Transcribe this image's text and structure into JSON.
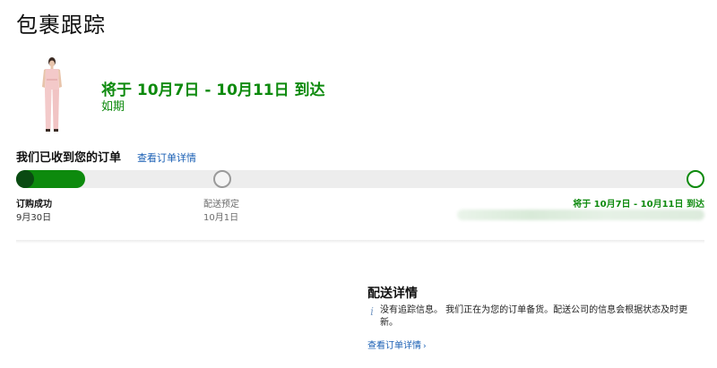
{
  "page": {
    "title": "包裹跟踪"
  },
  "shipment": {
    "headline": "将于 10月7日 - 10月11日 到达",
    "status": "如期",
    "product_image_icon": "dress-icon"
  },
  "order": {
    "received_title": "我们已收到您的订单",
    "view_details_link": "查看订单详情"
  },
  "progress": {
    "completed_fraction": 0.1,
    "steps": [
      {
        "name": "订购成功",
        "date": "9月30日",
        "state": "complete"
      },
      {
        "name": "配送预定",
        "date": "10月1日",
        "state": "pending"
      },
      {
        "name": "将于 10月7日 - 10月11日 到达",
        "date": "",
        "state": "pending"
      }
    ]
  },
  "shipping_details": {
    "title": "配送详情",
    "info_icon": "info-icon",
    "message": "没有追踪信息。 我们正在为您的订单备货。配送公司的信息会根据状态及时更新。",
    "view_order_link": "查看订单详情",
    "chevron_icon": "chevron-right-icon"
  },
  "colors": {
    "accent_green": "#0d8a0d",
    "dark_green": "#0a4a12",
    "link_blue": "#1a5fb4",
    "track_gray": "#ededed"
  }
}
